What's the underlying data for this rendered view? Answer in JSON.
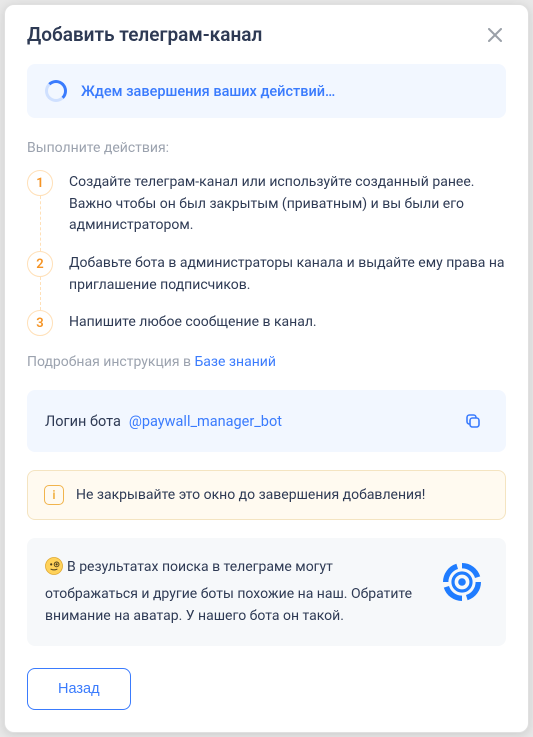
{
  "modal": {
    "title": "Добавить телеграм-канал",
    "status_text": "Ждем завершения ваших действий…",
    "section_label": "Выполните действия:",
    "steps": [
      "Создайте телеграм-канал или используйте созданный ранее. Важно чтобы он был закрытым (приватным) и вы были его администратором.",
      "Добавьте бота в администраторы канала и выдайте ему права на приглашение подписчиков.",
      "Напишите любое сообщение в канал."
    ],
    "kb_prefix": "Подробная инструкция в ",
    "kb_link": "Базе знаний",
    "login_label": "Логин бота",
    "login_value": "@paywall_manager_bot",
    "warn_text": "Не закрывайте это окно до завершения добавления!",
    "info_text": "В результатах поиска в телеграме могут отображаться и другие боты похожие на наш. Обратите внимание на аватар. У нашего бота он такой.",
    "back_label": "Назад"
  },
  "colors": {
    "accent": "#3a7bfd",
    "orange": "#f59425",
    "text": "#2e3a54",
    "muted": "#9ba2ae"
  }
}
